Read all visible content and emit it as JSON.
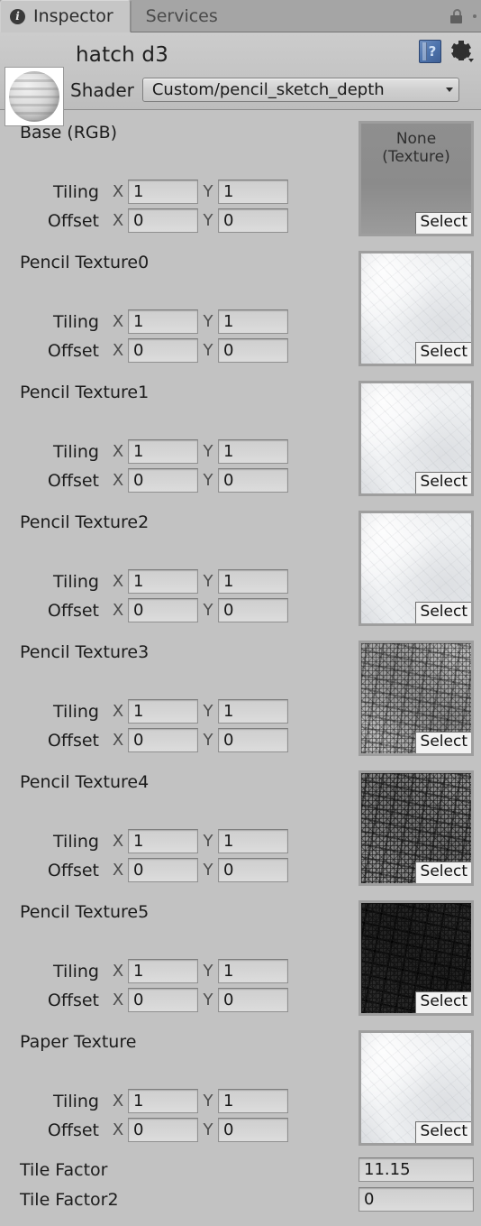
{
  "window": {
    "tabs": [
      {
        "label": "Inspector",
        "icon": "info-icon",
        "active": true
      },
      {
        "label": "Services",
        "icon": "",
        "active": false
      }
    ],
    "lock_icon": "lock-icon",
    "menu_icon": "kebab-menu-icon"
  },
  "header": {
    "material_name": "hatch d3",
    "preview_icon": "material-sphere-preview",
    "shader_label": "Shader",
    "shader_value": "Custom/pencil_sketch_depth",
    "help_icon": "help-book-icon",
    "gear_icon": "gear-icon"
  },
  "labels": {
    "tiling": "Tiling",
    "offset": "Offset",
    "axis_x": "X",
    "axis_y": "Y",
    "select": "Select"
  },
  "properties": [
    {
      "name": "Base (RGB)",
      "texture": {
        "kind": "none",
        "line1": "None",
        "line2": "(Texture)"
      },
      "tiling": {
        "x": "1",
        "y": "1"
      },
      "offset": {
        "x": "0",
        "y": "0"
      }
    },
    {
      "name": "Pencil Texture0",
      "texture": {
        "kind": "paper"
      },
      "tiling": {
        "x": "1",
        "y": "1"
      },
      "offset": {
        "x": "0",
        "y": "0"
      }
    },
    {
      "name": "Pencil Texture1",
      "texture": {
        "kind": "paper"
      },
      "tiling": {
        "x": "1",
        "y": "1"
      },
      "offset": {
        "x": "0",
        "y": "0"
      }
    },
    {
      "name": "Pencil Texture2",
      "texture": {
        "kind": "paper"
      },
      "tiling": {
        "x": "1",
        "y": "1"
      },
      "offset": {
        "x": "0",
        "y": "0"
      }
    },
    {
      "name": "Pencil Texture3",
      "texture": {
        "kind": "hatch-light"
      },
      "tiling": {
        "x": "1",
        "y": "1"
      },
      "offset": {
        "x": "0",
        "y": "0"
      }
    },
    {
      "name": "Pencil Texture4",
      "texture": {
        "kind": "hatch-medium"
      },
      "tiling": {
        "x": "1",
        "y": "1"
      },
      "offset": {
        "x": "0",
        "y": "0"
      }
    },
    {
      "name": "Pencil Texture5",
      "texture": {
        "kind": "hatch-dark"
      },
      "tiling": {
        "x": "1",
        "y": "1"
      },
      "offset": {
        "x": "0",
        "y": "0"
      }
    },
    {
      "name": "Paper Texture",
      "texture": {
        "kind": "paper"
      },
      "tiling": {
        "x": "1",
        "y": "1"
      },
      "offset": {
        "x": "0",
        "y": "0"
      }
    }
  ],
  "floats": [
    {
      "name": "Tile Factor",
      "value": "11.15"
    },
    {
      "name": "Tile Factor2",
      "value": "0"
    }
  ],
  "colors": {
    "background": "#c2c2c2",
    "tabbar": "#a5a5a5",
    "active_tab": "#c6c6c6",
    "field": "#d4d4d4",
    "text": "#1c1c1c",
    "help_blue": "#4e74ad"
  }
}
